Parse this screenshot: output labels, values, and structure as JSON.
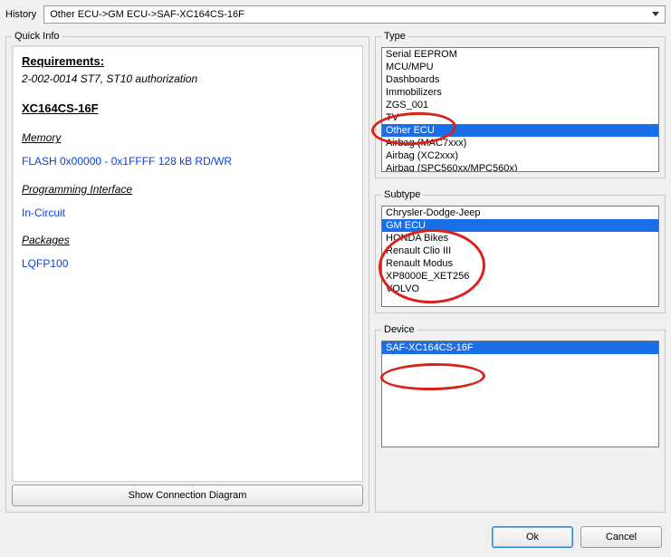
{
  "history": {
    "label": "History",
    "value": "Other ECU->GM ECU->SAF-XC164CS-16F"
  },
  "quick_info": {
    "legend": "Quick Info",
    "requirements_heading": "Requirements:",
    "requirements_line": "2-002-0014  ST7, ST10 authorization",
    "device_heading": "XC164CS-16F",
    "memory_heading": "Memory",
    "memory_line": "FLASH   0x00000 - 0x1FFFF   128 kB  RD/WR",
    "pi_heading": "Programming Interface",
    "pi_line": "In-Circuit",
    "packages_heading": "Packages",
    "packages_line": "LQFP100",
    "button": "Show Connection Diagram"
  },
  "type": {
    "legend": "Type",
    "items": [
      "Serial EEPROM",
      "MCU/MPU",
      "Dashboards",
      "Immobilizers",
      "ZGS_001",
      "TV",
      "Other ECU",
      "Airbag (MAC7xxx)",
      "Airbag (XC2xxx)",
      "Airbag (SPC560xx/MPC560x)"
    ],
    "selected": "Other ECU"
  },
  "subtype": {
    "legend": "Subtype",
    "items": [
      "Chrysler-Dodge-Jeep",
      "GM ECU",
      "HONDA Bikes",
      "Renault Clio III",
      "Renault Modus",
      "XP8000E_XET256",
      "VOLVO"
    ],
    "selected": "GM ECU"
  },
  "device": {
    "legend": "Device",
    "items": [
      "SAF-XC164CS-16F"
    ],
    "selected": "SAF-XC164CS-16F"
  },
  "footer": {
    "ok": "Ok",
    "cancel": "Cancel"
  }
}
